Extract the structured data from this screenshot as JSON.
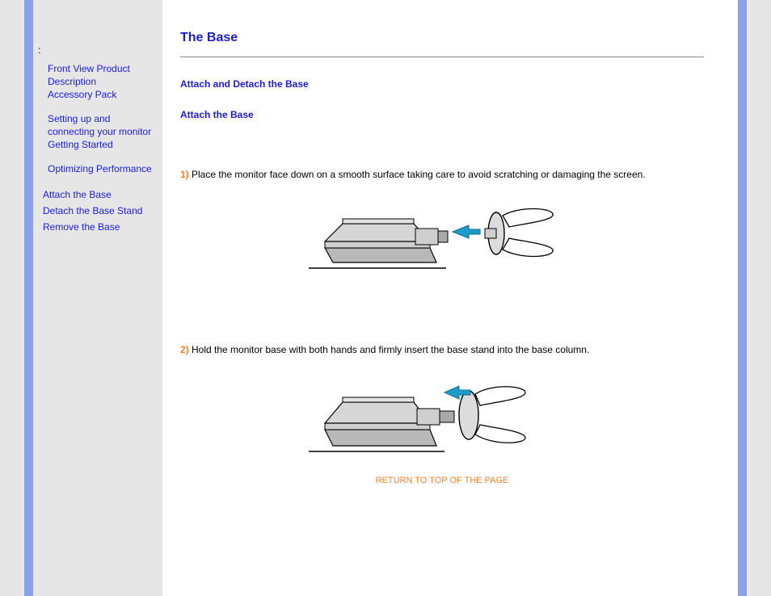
{
  "sidebar": {
    "colon": ":",
    "group1": [
      "Front View Product Description",
      "Accessory Pack"
    ],
    "group2": [
      "Setting up and connecting your monitor",
      "Getting Started"
    ],
    "group3": [
      "Optimizing Performance"
    ],
    "group4": [
      "Attach the Base",
      "Detach the Base Stand",
      "Remove the Base"
    ]
  },
  "main": {
    "title": "The Base",
    "section1_heading": "Attach and Detach the Base",
    "section2_heading": "Attach the Base",
    "step1_num": "1)",
    "step1_text": " Place the monitor face down on a smooth surface taking care to avoid scratching or damaging the screen.",
    "step2_num": "2)",
    "step2_text": " Hold the monitor base with both hands and firmly insert the base stand into the base column.",
    "return_link": "RETURN TO TOP OF THE PAGE"
  }
}
